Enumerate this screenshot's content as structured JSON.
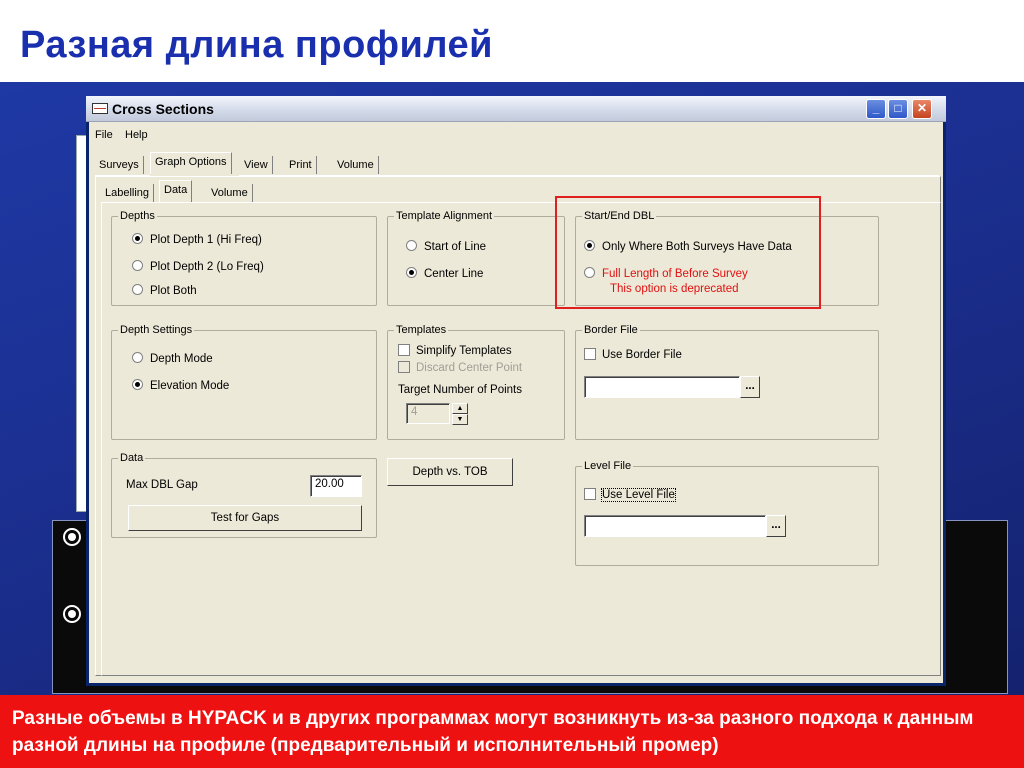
{
  "slide": {
    "title": "Разная длина профилей",
    "subtitle": "",
    "footer_text": "Разные объемы в HYPACK и в других программах могут возникнуть из-за разного подхода к данным разной длины на профиле (предварительный и исполнительный промер)"
  },
  "window": {
    "title": "Cross  Sections",
    "buttons": {
      "minimize": "_",
      "maximize": "□",
      "close": "✕"
    }
  },
  "menu": [
    "File",
    "Help"
  ],
  "top_tabs": [
    "Surveys",
    "Graph Options",
    "View",
    "Print",
    "Volume"
  ],
  "top_tabs_active": "Graph Options",
  "sub_tabs": [
    "Labelling",
    "Data",
    "Volume"
  ],
  "sub_tabs_active": "Data",
  "depths": {
    "label": "Depths",
    "options": [
      "Plot Depth 1 (Hi Freq)",
      "Plot Depth 2 (Lo Freq)",
      "Plot Both"
    ],
    "selected": "Plot Depth 1 (Hi Freq)"
  },
  "template_alignment": {
    "label": "Template Alignment",
    "options": [
      "Start of Line",
      "Center Line"
    ],
    "selected": "Center Line"
  },
  "start_end_dbl": {
    "label": "Start/End DBL",
    "option1": "Only Where Both Surveys Have Data",
    "option2_line1": "Full Length of Before Survey",
    "option2_line2": "This option is deprecated",
    "selected": "Only Where Both Surveys Have Data",
    "accent_color": "#e01010"
  },
  "depth_settings": {
    "label": "Depth Settings",
    "options": [
      "Depth Mode",
      "Elevation Mode"
    ],
    "selected": "Elevation Mode"
  },
  "templates": {
    "label": "Templates",
    "simplify_label": "Simplify Templates",
    "simplify_checked": false,
    "discard_label": "Discard Center Point",
    "discard_enabled": false,
    "target_label": "Target Number of Points",
    "target_value": "4"
  },
  "border_file": {
    "label": "Border File",
    "use_label": "Use Border File",
    "use_checked": false,
    "path_value": "",
    "browse_label": "..."
  },
  "data_group": {
    "label": "Data",
    "max_gap_label": "Max DBL Gap",
    "max_gap_value": "20.00",
    "test_button": "Test for Gaps"
  },
  "depth_vs_tob_button": "Depth vs. TOB",
  "level_file": {
    "label": "Level File",
    "use_label": "Use Level File",
    "use_checked": false,
    "path_value": "",
    "browse_label": "..."
  }
}
